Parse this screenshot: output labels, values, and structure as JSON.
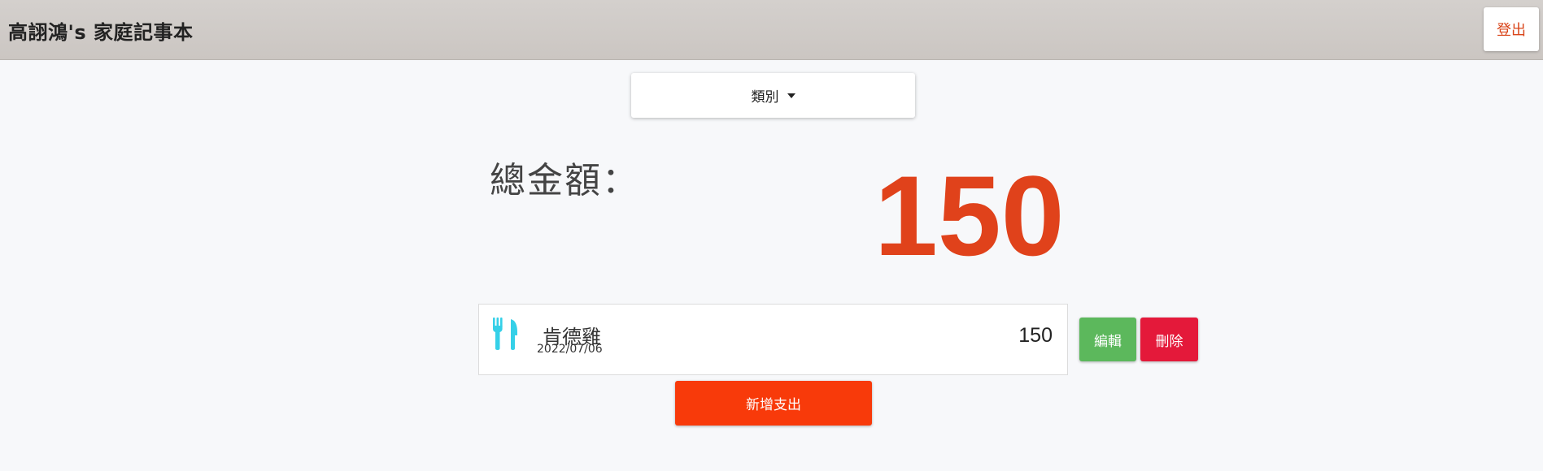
{
  "header": {
    "title": "高詡鴻's 家庭記事本",
    "logout_label": "登出"
  },
  "filter": {
    "category_label": "類別"
  },
  "summary": {
    "total_label": "總金額：",
    "total_value": "150"
  },
  "expenses": [
    {
      "icon": "utensils-icon",
      "name": "肯德雞",
      "date": "2022/07/06",
      "amount": "150",
      "edit_label": "編輯",
      "delete_label": "刪除"
    }
  ],
  "actions": {
    "add_expense_label": "新增支出"
  },
  "colors": {
    "accent": "#e0421b",
    "edit": "#5cb85c",
    "delete": "#e4193a",
    "add": "#f83a0a",
    "icon": "#35d0e8"
  }
}
